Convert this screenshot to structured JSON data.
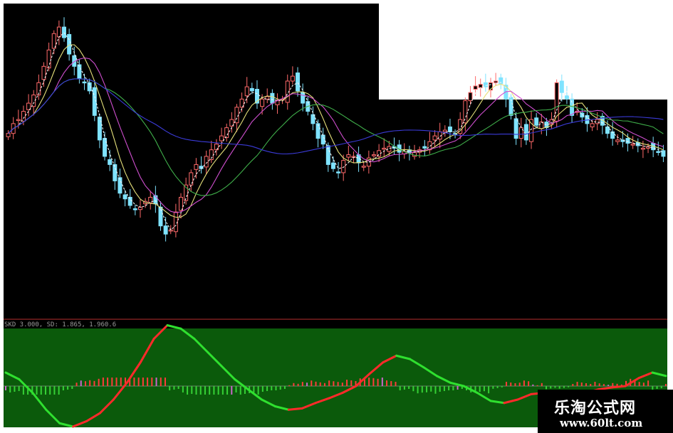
{
  "chart_data": [
    {
      "type": "candlestick",
      "panel": "price",
      "background": "#000000",
      "colors": {
        "up": "#ff6a6a",
        "down": "#7fe3ff",
        "ma_white": "#f2f2f2",
        "ma_yellow": "#e5e07a",
        "ma_magenta": "#d04fd0",
        "ma_green": "#3fae4a",
        "ma_blue": "#3b3bd8"
      },
      "closes": [
        188,
        200,
        205,
        215,
        225,
        235,
        250,
        270,
        290,
        310,
        318,
        305,
        285,
        270,
        255,
        250,
        240,
        210,
        180,
        160,
        150,
        130,
        115,
        108,
        100,
        95,
        98,
        105,
        110,
        102,
        75,
        65,
        70,
        92,
        110,
        125,
        140,
        150,
        145,
        160,
        168,
        175,
        185,
        195,
        205,
        220,
        230,
        245,
        240,
        225,
        230,
        233,
        225,
        228,
        230,
        252,
        258,
        240,
        225,
        215,
        200,
        182,
        175,
        150,
        145,
        140,
        155,
        162,
        160,
        152,
        148,
        158,
        162,
        167,
        170,
        172,
        170,
        165,
        166,
        164,
        165,
        168,
        170,
        178,
        185,
        190,
        192,
        190,
        186,
        205,
        228,
        238,
        246,
        248,
        245,
        250,
        252,
        249,
        230,
        210,
        182,
        195,
        180,
        205,
        198,
        202,
        195,
        205,
        250,
        238,
        230,
        210,
        215,
        208,
        200,
        200,
        205,
        198,
        188,
        182,
        180,
        178,
        176,
        175,
        173,
        170,
        172,
        168,
        165,
        160
      ]
    },
    {
      "type": "line",
      "panel": "indicator",
      "background": "#0b5a0b",
      "colors": {
        "rising": "#ff2a2a",
        "falling": "#2fe02f",
        "histogram_up": "#ff3b3b",
        "histogram_down": "#35d035",
        "histogram_alt": "#cc66cc"
      },
      "values": [
        20,
        10,
        -10,
        -35,
        -55,
        -60,
        -52,
        -40,
        -20,
        5,
        35,
        70,
        90,
        85,
        70,
        50,
        30,
        10,
        -5,
        -20,
        -30,
        -35,
        -33,
        -25,
        -18,
        -10,
        0,
        18,
        35,
        45,
        40,
        28,
        15,
        5,
        0,
        -10,
        -22,
        -25,
        -20,
        -12,
        -10,
        -14,
        -15,
        -10,
        -5,
        -2,
        0,
        12,
        20,
        15
      ]
    }
  ],
  "overlay": {
    "indicator_header": "SKD 3.000, SD: 1.865, 1.960.6"
  },
  "watermark": {
    "title": "乐淘公式网",
    "url": "www.60lt.com"
  }
}
